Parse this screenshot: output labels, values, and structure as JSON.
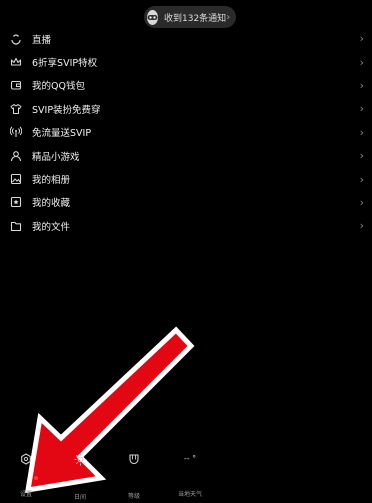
{
  "notification": {
    "text": "收到132条通知",
    "icon": "avatar-icon"
  },
  "menu": [
    {
      "label": "直播",
      "icon": "live-icon"
    },
    {
      "label": "6折享SVIP特权",
      "icon": "crown-icon"
    },
    {
      "label": "我的QQ钱包",
      "icon": "wallet-icon"
    },
    {
      "label": "SVIP装扮免费穿",
      "icon": "shirt-icon"
    },
    {
      "label": "免流量送SVIP",
      "icon": "signal-icon"
    },
    {
      "label": "精品小游戏",
      "icon": "person-game-icon"
    },
    {
      "label": "我的相册",
      "icon": "photo-icon"
    },
    {
      "label": "我的收藏",
      "icon": "bookmark-icon"
    },
    {
      "label": "我的文件",
      "icon": "folder-icon"
    }
  ],
  "bottom_nav": [
    {
      "label": "设置",
      "icon": "settings-icon"
    },
    {
      "label": "日间",
      "icon": "sun-icon"
    },
    {
      "label": "等级",
      "icon": "shield-icon"
    },
    {
      "label": "当地天气",
      "icon": "weather-icon",
      "value": "-- °"
    }
  ],
  "colors": {
    "background": "#000000",
    "arrow": "#e30613",
    "badge": "#ff3b30"
  }
}
